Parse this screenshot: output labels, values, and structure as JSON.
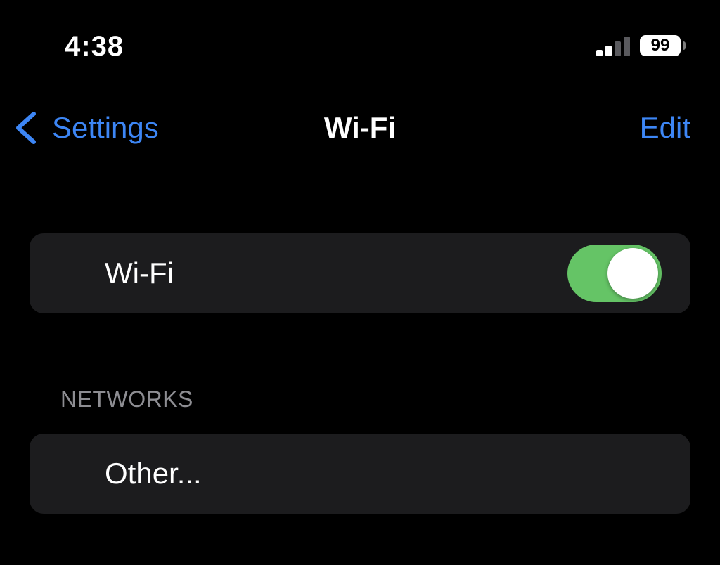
{
  "colors": {
    "background": "#000000",
    "cell_background": "#1c1c1e",
    "accent_blue": "#3d86f5",
    "toggle_on": "#65c466",
    "section_header": "#8d8d92",
    "signal_active": "#ffffff",
    "signal_inactive": "#5a5a5e"
  },
  "status_bar": {
    "time": "4:38",
    "battery_level": "99",
    "signal_bars_active": 2,
    "signal_bars_total": 4
  },
  "nav": {
    "back_icon": "chevron-left-icon",
    "back_label": "Settings",
    "title": "Wi-Fi",
    "edit_label": "Edit"
  },
  "wifi_section": {
    "label": "Wi-Fi",
    "toggle_on": true
  },
  "networks_section": {
    "header": "NETWORKS",
    "items": [
      {
        "label": "Other..."
      }
    ]
  }
}
